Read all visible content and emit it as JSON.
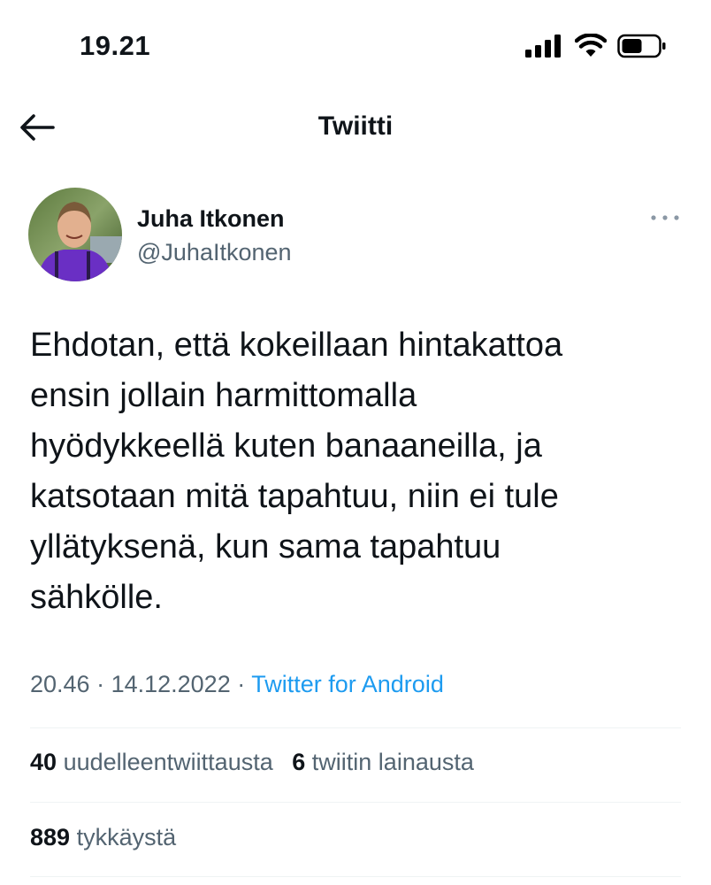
{
  "status_bar": {
    "time": "19.21",
    "icons": [
      "signal-icon",
      "wifi-icon",
      "battery-icon"
    ]
  },
  "header": {
    "title": "Twiitti",
    "back_icon": "back-arrow-icon"
  },
  "author": {
    "name": "Juha Itkonen",
    "handle": "@JuhaItkonen",
    "more_icon": "more-dots-icon"
  },
  "tweet": {
    "text": "Ehdotan, että kokeillaan hintakattoa\nensin jollain harmittomalla\nhyödykkeellä kuten banaaneilla, ja\nkatsotaan mitä tapahtuu, niin ei tule\nyllätyksenä, kun sama tapahtuu\nsähkölle.",
    "time": "20.46",
    "date": "14.12.2022",
    "source": "Twitter for Android",
    "separator": " · "
  },
  "stats": {
    "retweets_count": "40",
    "retweets_label": "uudelleentwiittausta",
    "quotes_count": "6",
    "quotes_label": "twiitin lainausta",
    "likes_count": "889",
    "likes_label": "tykkäystä"
  },
  "colors": {
    "text": "#0f1419",
    "secondary": "#536471",
    "link": "#1d9bf0",
    "divider": "#eff3f4"
  }
}
